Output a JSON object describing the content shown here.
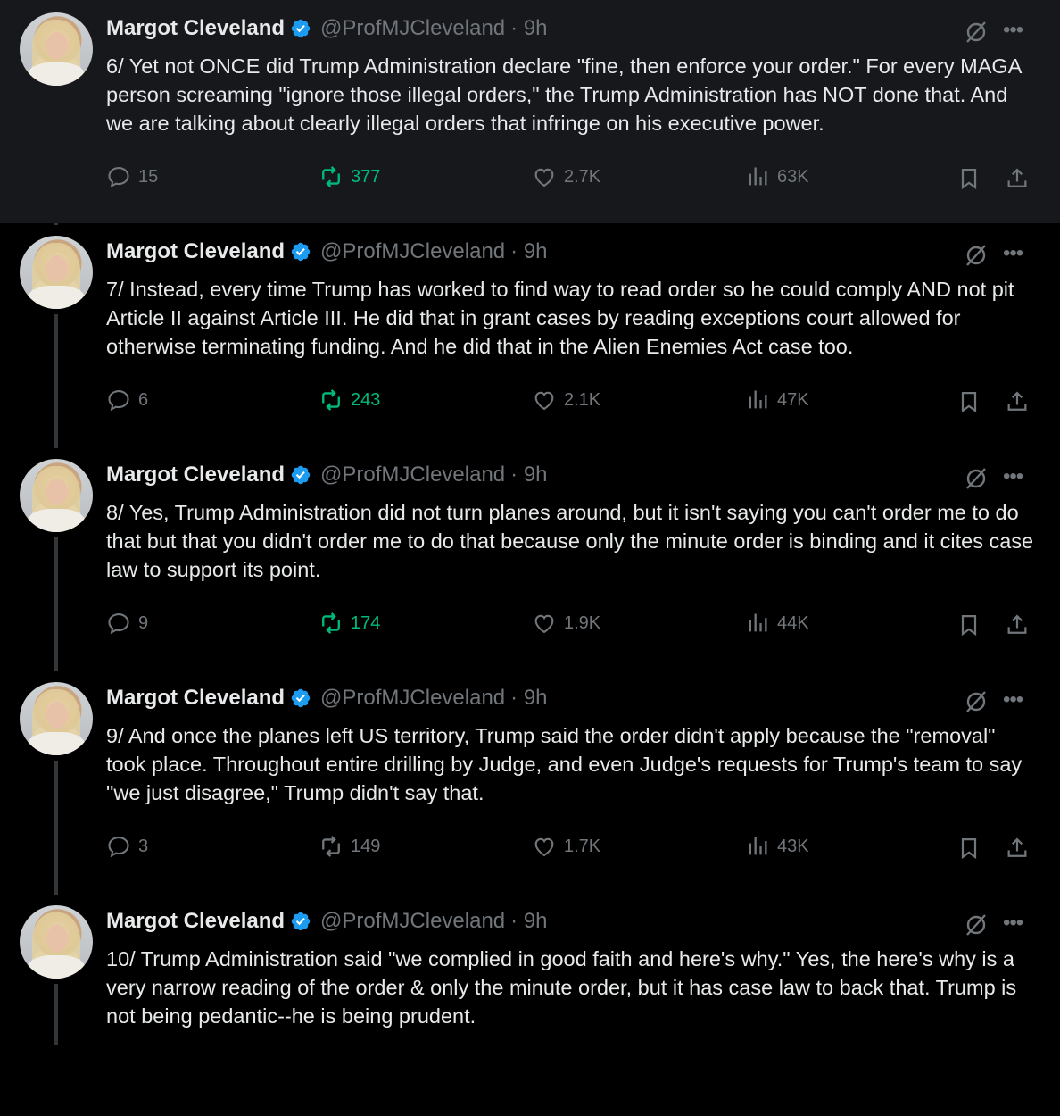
{
  "author": {
    "name": "Margot Cleveland",
    "handle": "@ProfMJCleveland",
    "time": "· 9h"
  },
  "colors": {
    "background": "#000000",
    "highlight_background": "#16181c",
    "verified_blue": "#1d9bf0",
    "muted_text": "#71767b",
    "repost_green": "#00ba7c"
  },
  "tweets": [
    {
      "text": "6/ Yet not ONCE did Trump Administration declare \"fine, then enforce your order.\" For every MAGA person screaming \"ignore those illegal orders,\" the Trump Administration has NOT done that. And we are talking about clearly illegal orders that infringe on his executive power.",
      "replies": "15",
      "reposts": "377",
      "likes": "2.7K",
      "views": "63K",
      "reposted": true
    },
    {
      "text": "7/ Instead, every time Trump has worked to find way to read order so he could comply AND not pit Article II against Article III. He did that in grant cases by reading exceptions court allowed for otherwise terminating funding. And he did that in the Alien Enemies Act case too.",
      "replies": "6",
      "reposts": "243",
      "likes": "2.1K",
      "views": "47K",
      "reposted": true
    },
    {
      "text": "8/ Yes, Trump Administration did not turn planes around, but it isn't saying you can't order me to do that but that you didn't order me to do that because only the minute order is binding and it cites case law to support its point.",
      "replies": "9",
      "reposts": "174",
      "likes": "1.9K",
      "views": "44K",
      "reposted": true
    },
    {
      "text": "9/ And once the planes left US territory, Trump said the order didn't apply because the \"removal\" took place. Throughout entire drilling by Judge, and even Judge's requests for Trump's team to say \"we just disagree,\" Trump didn't say that.",
      "replies": "3",
      "reposts": "149",
      "likes": "1.7K",
      "views": "43K",
      "reposted": false
    },
    {
      "text": "10/ Trump Administration said \"we complied in good faith and here's why.\" Yes, the here's why is a very narrow reading of the order & only the minute order, but it has case law to back that. Trump is not being pedantic--he is being prudent.",
      "replies": "",
      "reposts": "",
      "likes": "",
      "views": "",
      "reposted": false
    }
  ]
}
